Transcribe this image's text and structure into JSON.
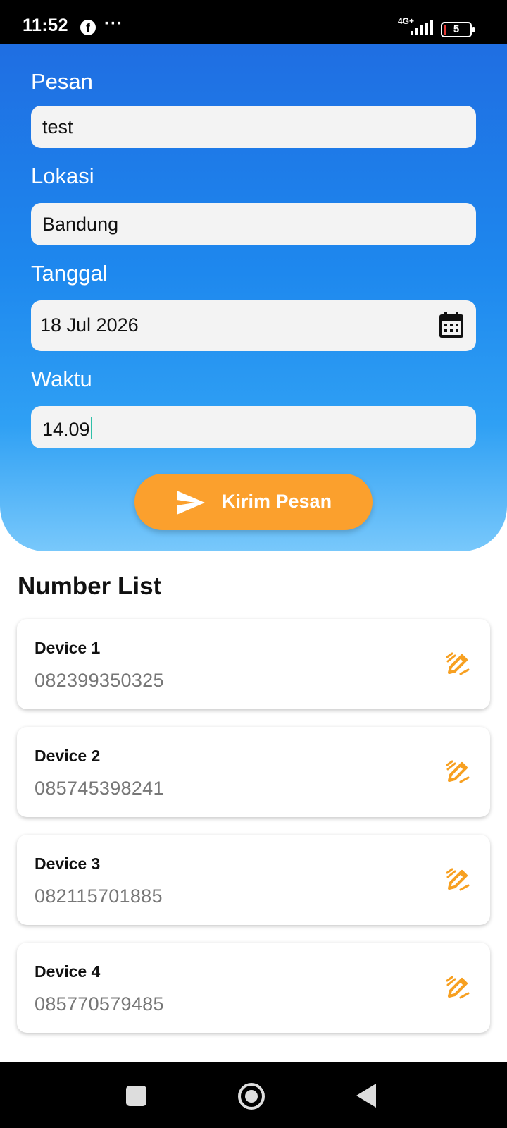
{
  "status_bar": {
    "time": "11:52",
    "network": "4G+",
    "battery": "5"
  },
  "form": {
    "message_label": "Pesan",
    "message_value": "test",
    "location_label": "Lokasi",
    "location_value": "Bandung",
    "date_label": "Tanggal",
    "date_value": "18 Jul 2026",
    "time_label": "Waktu",
    "time_value": "14.09",
    "send_button_label": "Kirim Pesan"
  },
  "number_list": {
    "title": "Number List",
    "items": [
      {
        "name": "Device 1",
        "number": "082399350325"
      },
      {
        "name": "Device 2",
        "number": "085745398241"
      },
      {
        "name": "Device 3",
        "number": "082115701885"
      },
      {
        "name": "Device 4",
        "number": "085770579485"
      }
    ]
  },
  "colors": {
    "gradient_top": "#1f6ee2",
    "gradient_bottom": "#78c8fb",
    "accent_orange": "#fba02d"
  },
  "icons": [
    "facebook-icon",
    "more-icon",
    "signal-icon",
    "battery-icon",
    "calendar-icon",
    "send-icon",
    "edit-icon",
    "recents-icon",
    "home-icon",
    "back-icon"
  ]
}
